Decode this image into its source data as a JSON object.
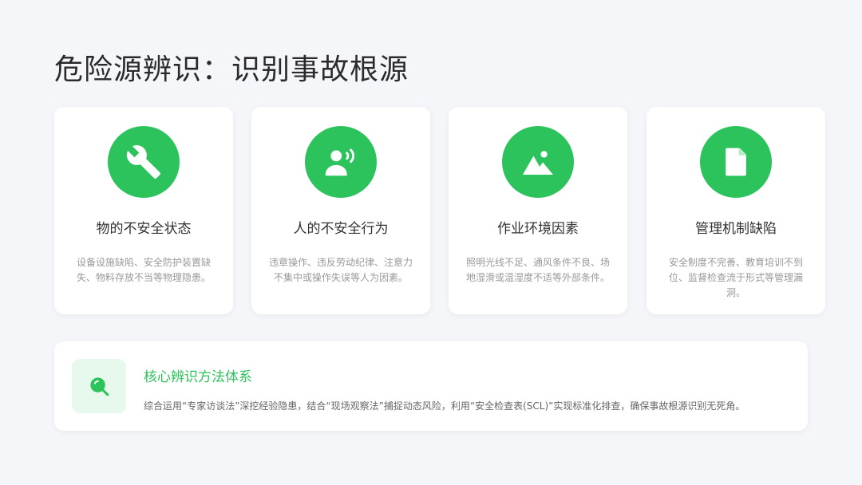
{
  "page": {
    "title": "危险源辨识：识别事故根源"
  },
  "cards": [
    {
      "icon": "wrench-icon",
      "heading": "物的不安全状态",
      "description": "设备设施缺陷、安全防护装置缺失、物料存放不当等物理隐患。"
    },
    {
      "icon": "person-speaking-icon",
      "heading": "人的不安全行为",
      "description": "违章操作、违反劳动纪律、注意力不集中或操作失误等人为因素。"
    },
    {
      "icon": "landscape-image-icon",
      "heading": "作业环境因素",
      "description": "照明光线不足、通风条件不良、场地湿滑或温湿度不适等外部条件。"
    },
    {
      "icon": "document-icon",
      "heading": "管理机制缺陷",
      "description": "安全制度不完善、教育培训不到位、监督检查流于形式等管理漏洞。"
    }
  ],
  "method": {
    "icon": "search-icon",
    "title": "核心辨识方法体系",
    "description": "综合运用“专家访谈法”深挖经验隐患，结合“现场观察法”捕捉动态风险，利用“安全检查表(SCL)”实现标准化排查，确保事故根源识别无死角。"
  },
  "colors": {
    "accent": "#2cc25c",
    "badge_background": "#e7f8ec",
    "page_background": "#f4f6f9",
    "title_text": "#2b2b2b",
    "muted_text": "#999999"
  }
}
